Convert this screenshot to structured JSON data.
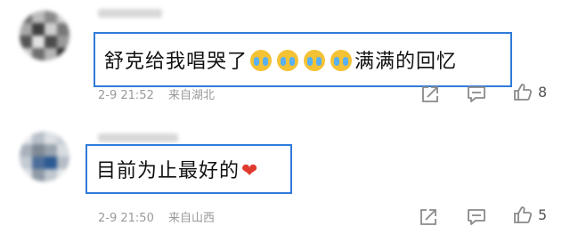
{
  "comments": [
    {
      "text_before": "舒克给我唱哭了",
      "emojis": [
        "crying-emoji",
        "crying-emoji",
        "crying-emoji",
        "crying-emoji"
      ],
      "text_after": "满满的回忆",
      "date": "2-9",
      "time": "21:52",
      "location": "来自湖北",
      "like_count": "8"
    },
    {
      "text_before": "目前为止最好的",
      "emojis": [
        "heart-emoji"
      ],
      "text_after": "",
      "date": "2-9",
      "time": "21:50",
      "location": "来自山西",
      "like_count": "5"
    }
  ],
  "colors": {
    "highlight_border": "#2f7bd9",
    "meta_text": "#9a9a9a",
    "heart": "#e03a2e"
  }
}
